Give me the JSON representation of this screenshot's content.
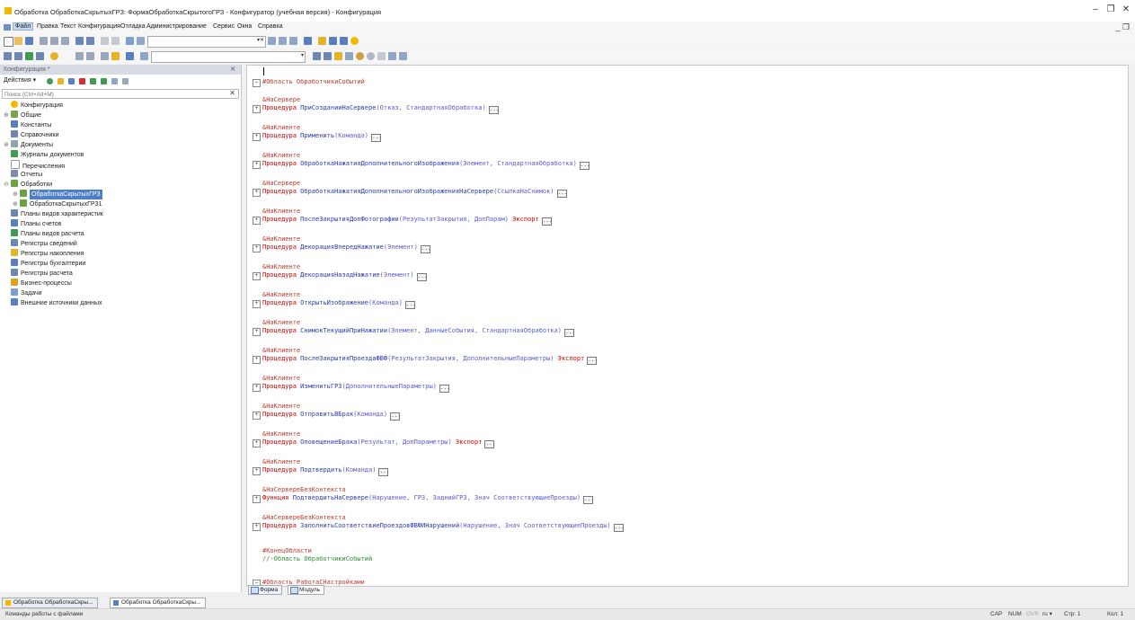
{
  "window": {
    "title": "Обработка ОбработкаСкрытыхГРЗ: ФормаОбработкаСкрытогоГРЗ - Конфигуратор (учебная версия) - Конфигурация",
    "minimize": "–",
    "maximize": "❐",
    "close": "✕"
  },
  "menu": {
    "items": [
      "Файл",
      "Правка",
      "Текст",
      "Конфигурация",
      "Отладка",
      "Администрирование",
      "Сервис",
      "Окна",
      "Справка"
    ],
    "right_controls": "_ ❐"
  },
  "config_panel": {
    "title": "Конфигурация *",
    "close": "✕",
    "actions_label": "Действия ▾",
    "search_placeholder": "Поиск (Ctrl+Alt+M)",
    "tree": [
      {
        "label": "Конфигурация",
        "icon": "config-icon",
        "color": "#f5b800"
      },
      {
        "label": "Общие",
        "icon": "common-icon",
        "color": "#7aa34a"
      },
      {
        "label": "Константы",
        "icon": "constants-icon",
        "color": "#5a7fc0"
      },
      {
        "label": "Справочники",
        "icon": "catalogs-icon",
        "color": "#6d87b5"
      },
      {
        "label": "Документы",
        "icon": "documents-icon",
        "color": "#9aa0aa"
      },
      {
        "label": "Журналы документов",
        "icon": "journals-icon",
        "color": "#3f9a54"
      },
      {
        "label": "Перечисления",
        "icon": "enums-icon",
        "color": "#999999"
      },
      {
        "label": "Отчеты",
        "icon": "reports-icon",
        "color": "#7f8da6"
      },
      {
        "label": "Обработки",
        "icon": "dataprocessors-icon",
        "color": "#6aa24a"
      },
      {
        "label": "ОбработкаСкрытыхГРЗ",
        "icon": "dataprocessor-icon",
        "color": "#6aa24a"
      },
      {
        "label": "ОбработкаСкрытыхГРЗ1",
        "icon": "dataprocessor-icon",
        "color": "#6aa24a"
      },
      {
        "label": "Планы видов характеристик",
        "icon": "chart-types-icon",
        "color": "#6d87b5"
      },
      {
        "label": "Планы счетов",
        "icon": "accounts-icon",
        "color": "#5a7fc0"
      },
      {
        "label": "Планы видов расчета",
        "icon": "calc-types-icon",
        "color": "#3f9a54"
      },
      {
        "label": "Регистры сведений",
        "icon": "info-registers-icon",
        "color": "#6d87b5"
      },
      {
        "label": "Регистры накопления",
        "icon": "accum-registers-icon",
        "color": "#e6b422"
      },
      {
        "label": "Регистры бухгалтерии",
        "icon": "acc-registers-icon",
        "color": "#5a7fc0"
      },
      {
        "label": "Регистры расчета",
        "icon": "calc-registers-icon",
        "color": "#6d87b5"
      },
      {
        "label": "Бизнес-процессы",
        "icon": "bp-icon",
        "color": "#e0a020"
      },
      {
        "label": "Задачи",
        "icon": "tasks-icon",
        "color": "#7aa0d0"
      },
      {
        "label": "Внешние источники данных",
        "icon": "external-sources-icon",
        "color": "#5a7fc0"
      }
    ]
  },
  "editor": {
    "region_start": "#Область ОбработчикиСобытий",
    "blocks": [
      {
        "directive": "&НаСервере",
        "kw": "Процедура",
        "name": "ПриСозданииНаСервере",
        "params": "(Отказ, СтандартнаяОбработка)",
        "export": ""
      },
      {
        "directive": "&НаКлиенте",
        "kw": "Процедура",
        "name": "Применить",
        "params": "(Команда)",
        "export": ""
      },
      {
        "directive": "&НаКлиенте",
        "kw": "Процедура",
        "name": "ОбработкаНажатияДополнительногоИзображения",
        "params": "(Элемент, СтандартнаяОбработка)",
        "export": ""
      },
      {
        "directive": "&НаСервере",
        "kw": "Процедура",
        "name": "ОбработкаНажатияДополнительногоИзображенияНаСервере",
        "params": "(СсылкаНаСнимок)",
        "export": ""
      },
      {
        "directive": "&НаКлиенте",
        "kw": "Процедура",
        "name": "ПослеЗакрытияДопФотографии",
        "params": "(РезультатЗакрытия, ДопПарам)",
        "export": "Экспорт"
      },
      {
        "directive": "&НаКлиенте",
        "kw": "Процедура",
        "name": "ДекорацияВпередНажатие",
        "params": "(Элемент)",
        "export": ""
      },
      {
        "directive": "&НаКлиенте",
        "kw": "Процедура",
        "name": "ДекорацияНазадНажатие",
        "params": "(Элемент)",
        "export": ""
      },
      {
        "directive": "&НаКлиенте",
        "kw": "Процедура",
        "name": "ОткрытьИзображение",
        "params": "(Команда)",
        "export": ""
      },
      {
        "directive": "&НаКлиенте",
        "kw": "Процедура",
        "name": "СнимокТекущийПриНажатии",
        "params": "(Элемент, ДанныеСобытия, СтандартнаяОбработка)",
        "export": ""
      },
      {
        "directive": "&НаКлиенте",
        "kw": "Процедура",
        "name": "ПослеЗакрытияПроездаФВФ",
        "params": "(РезультатЗакрытия, ДополнительныеПараметры)",
        "export": "Экспорт"
      },
      {
        "directive": "&НаКлиенте",
        "kw": "Процедура",
        "name": "ИзменитьГРЗ",
        "params": "(ДополнительныеПараметры)",
        "export": ""
      },
      {
        "directive": "&НаКлиенте",
        "kw": "Процедура",
        "name": "ОтправитьВБрак",
        "params": "(Команда)",
        "export": ""
      },
      {
        "directive": "&НаКлиенте",
        "kw": "Процедура",
        "name": "ОповещениеБрака",
        "params": "(Результат, ДопПараметры)",
        "export": "Экспорт"
      },
      {
        "directive": "&НаКлиенте",
        "kw": "Процедура",
        "name": "Подтвердить",
        "params": "(Команда)",
        "export": ""
      },
      {
        "directive": "&НаСервереБезКонтекста",
        "kw": "Функция",
        "name": "ПодтвердитьНаСервере",
        "params": "(Нарушение, ГРЗ, ЗаднийГРЗ, Знач СоответствующиеПроезды)",
        "export": ""
      },
      {
        "directive": "&НаСервереБезКонтекста",
        "kw": "Процедура",
        "name": "ЗаполнитьСоответствиеПроездовФВФИНарушений",
        "params": "(Нарушение, Знач СоответствующиеПроезды)",
        "export": ""
      }
    ],
    "region_end": "#КонецОбласти",
    "region_end_comment": "//-Область ОбработчикиСобытий",
    "next_region": "#Область РаботаСНастройками",
    "collapsed_marker": "..."
  },
  "bottom_tabs": [
    "Форма",
    "Модуль"
  ],
  "taskbar": [
    "Обработка ОбработкаСкры...",
    "Обработка ОбработкаСкры..."
  ],
  "status": {
    "left": "Команды работы с файлами",
    "cap": "CAP",
    "num": "NUM",
    "ovr": "OVR",
    "lang": "ru ▾",
    "line": "Стр: 1",
    "col": "Кол: 1"
  }
}
